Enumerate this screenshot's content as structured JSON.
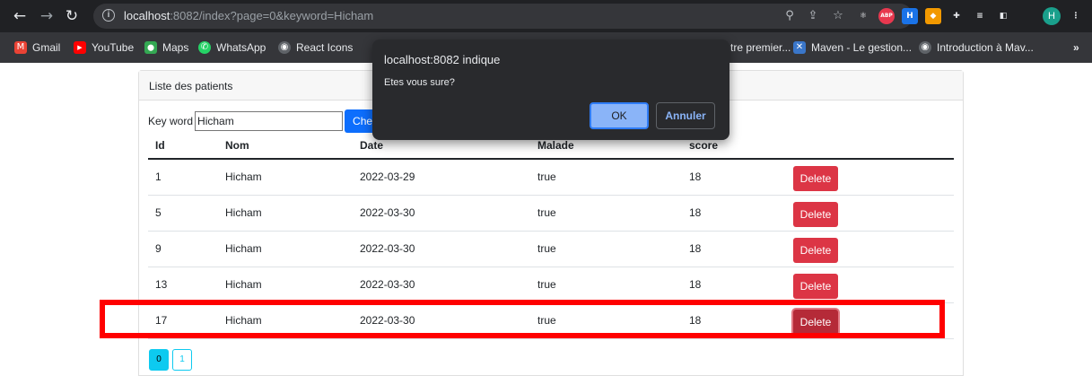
{
  "browser": {
    "url_host": "localhost",
    "url_rest": ":8082/index?page=0&keyword=Hicham",
    "avatar_letter": "H",
    "ext_abp": "ABP",
    "bookmarks": [
      {
        "label": "Gmail",
        "icon": "gmail-icon",
        "color": "#ea4335",
        "glyph": "M"
      },
      {
        "label": "YouTube",
        "icon": "youtube-icon",
        "color": "#ff0000",
        "glyph": "▶"
      },
      {
        "label": "Maps",
        "icon": "maps-icon",
        "color": "#34a853",
        "glyph": "⬤"
      },
      {
        "label": "WhatsApp",
        "icon": "whatsapp-icon",
        "color": "#25d366",
        "glyph": "✆"
      },
      {
        "label": "React Icons",
        "icon": "globe-icon",
        "color": "#5f6368",
        "glyph": "◉"
      },
      {
        "label": "tre premier...",
        "icon": "",
        "color": "",
        "glyph": ""
      },
      {
        "label": "Maven - Le gestion...",
        "icon": "maven-icon",
        "color": "#3a76c9",
        "glyph": "✕"
      },
      {
        "label": "Introduction à Mav...",
        "icon": "globe-icon",
        "color": "#5f6368",
        "glyph": "◉"
      }
    ],
    "more_bookmarks": "»"
  },
  "card": {
    "header": "Liste des patients",
    "search": {
      "label": "Key word",
      "value": "Hicham",
      "button": "Chercher"
    },
    "table": {
      "headers": [
        "Id",
        "Nom",
        "Date",
        "Malade",
        "score"
      ],
      "rows": [
        {
          "id": "1",
          "nom": "Hicham",
          "date": "2022-03-29",
          "malade": "true",
          "score": "18",
          "action": "Delete"
        },
        {
          "id": "5",
          "nom": "Hicham",
          "date": "2022-03-30",
          "malade": "true",
          "score": "18",
          "action": "Delete"
        },
        {
          "id": "9",
          "nom": "Hicham",
          "date": "2022-03-30",
          "malade": "true",
          "score": "18",
          "action": "Delete"
        },
        {
          "id": "13",
          "nom": "Hicham",
          "date": "2022-03-30",
          "malade": "true",
          "score": "18",
          "action": "Delete"
        },
        {
          "id": "17",
          "nom": "Hicham",
          "date": "2022-03-30",
          "malade": "true",
          "score": "18",
          "action": "Delete"
        }
      ]
    },
    "pages": [
      "0",
      "1"
    ],
    "active_page": "0"
  },
  "dialog": {
    "title": "localhost:8082 indique",
    "message": "Etes vous sure?",
    "ok": "OK",
    "cancel": "Annuler"
  },
  "colors": {
    "highlight": "#ff0000",
    "primary": "#0d6efd",
    "danger": "#dc3545",
    "info": "#0dcaf0"
  }
}
